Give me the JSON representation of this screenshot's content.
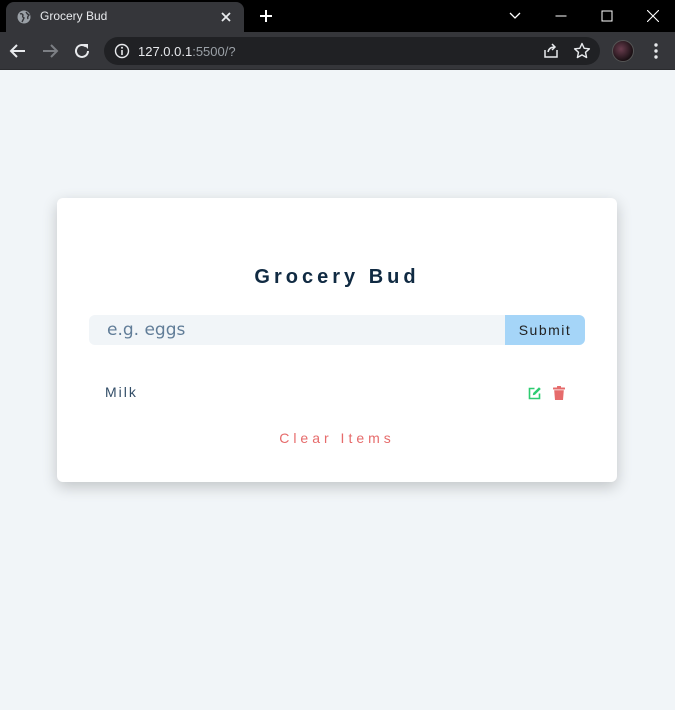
{
  "browser": {
    "tab_title": "Grocery Bud",
    "url_host": "127.0.0.1",
    "url_rest": ":5500/?",
    "favicon": "globe-icon"
  },
  "app": {
    "title": "Grocery Bud",
    "input_placeholder": "e.g. eggs",
    "input_value": "",
    "submit_label": "Submit",
    "clear_label": "Clear Items",
    "items": [
      {
        "title": "Milk"
      }
    ]
  },
  "colors": {
    "heading": "#102a42",
    "submit_bg": "#a5d5f8",
    "edit": "#2ecc71",
    "delete": "#e66b6b",
    "clear": "#e66b6b",
    "page_bg": "#f1f5f8"
  }
}
